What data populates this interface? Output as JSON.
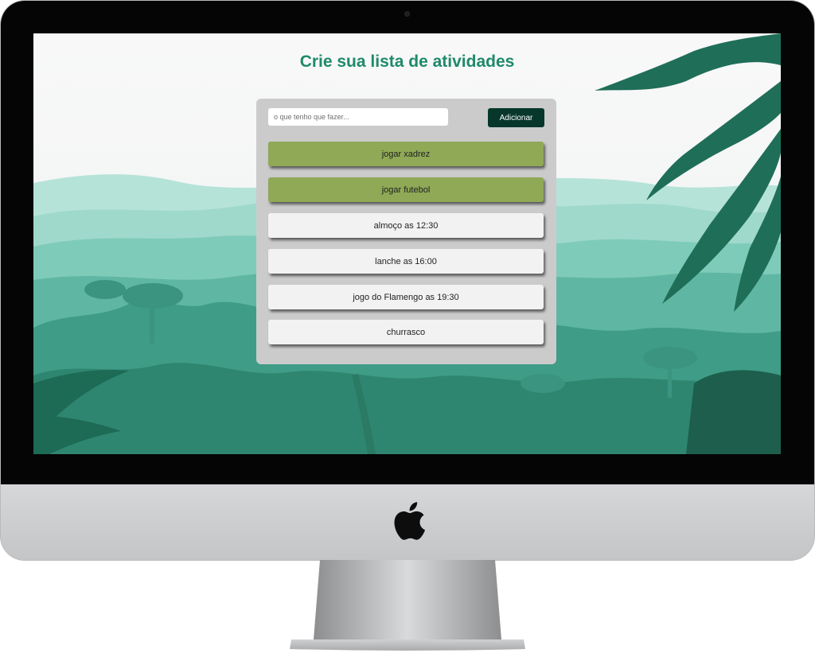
{
  "page": {
    "title": "Crie sua lista de atividades"
  },
  "form": {
    "placeholder": "o que tenho que fazer...",
    "value": "",
    "add_label": "Adicionar"
  },
  "tasks": [
    {
      "label": "jogar xadrez",
      "done": true
    },
    {
      "label": "jogar futebol",
      "done": true
    },
    {
      "label": "almoço as 12:30",
      "done": false
    },
    {
      "label": "lanche as 16:00",
      "done": false
    },
    {
      "label": "jogo do Flamengo as 19:30",
      "done": false
    },
    {
      "label": "churrasco",
      "done": false
    }
  ],
  "colors": {
    "title": "#1e8a6a",
    "panel": "#cbcbcb",
    "button": "#06372a",
    "task_done": "#8fa956",
    "task_pending": "#f2f2f2"
  },
  "icons": {
    "brand": "apple-logo-icon",
    "camera": "camera-icon"
  }
}
